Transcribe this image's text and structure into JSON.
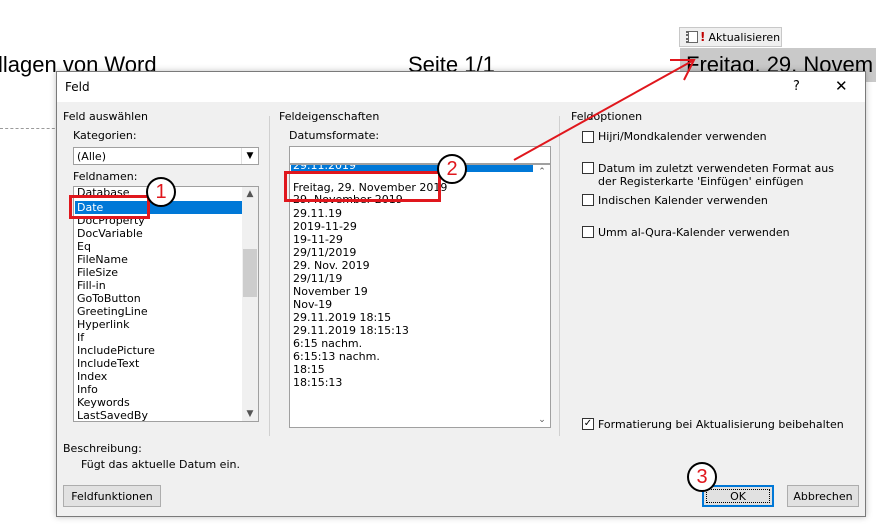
{
  "document": {
    "left_text": "llagen von Word",
    "center_text": "Seite 1/1",
    "update_button_label": "Aktualisieren",
    "field_value": "Freitag, 29. Novem"
  },
  "dialog": {
    "title": "Feld",
    "help_label": "?",
    "close_label": "✕",
    "left": {
      "section_title": "Feld auswählen",
      "category_label": "Kategorien:",
      "category_value": "(Alle)",
      "fieldnames_label": "Feldnamen:",
      "fieldnames": [
        "Database",
        "Date",
        "DocProperty",
        "DocVariable",
        "Eq",
        "FileName",
        "FileSize",
        "Fill-in",
        "GoToButton",
        "GreetingLine",
        "Hyperlink",
        "If",
        "IncludePicture",
        "IncludeText",
        "Index",
        "Info",
        "Keywords",
        "LastSavedBy"
      ],
      "selected_fieldname": "Date"
    },
    "middle": {
      "section_title": "Feldeigenschaften",
      "formats_label": "Datumsformate:",
      "format_input_value": "",
      "formats": [
        "29.11.2019",
        "Freitag, 29. November 2019",
        "29. November 2019",
        "29.11.19",
        "2019-11-29",
        "19-11-29",
        "29/11/2019",
        "29. Nov. 2019",
        "29/11/19",
        "November 19",
        "Nov-19",
        "29.11.2019 18:15",
        "29.11.2019 18:15:13",
        "6:15 nachm.",
        "6:15:13 nachm.",
        "18:15",
        "18:15:13"
      ]
    },
    "right": {
      "section_title": "Feldoptionen",
      "options": [
        {
          "label": "Hijri/Mondkalender verwenden",
          "checked": false
        },
        {
          "label": "Datum im zuletzt verwendeten Format aus der Registerkarte 'Einfügen' einfügen",
          "checked": false
        },
        {
          "label": "Indischen Kalender verwenden",
          "checked": false
        },
        {
          "label": "Umm al-Qura-Kalender verwenden",
          "checked": false
        }
      ],
      "preserve_label": "Formatierung bei Aktualisierung beibehalten",
      "preserve_checked": true
    },
    "description_label": "Beschreibung:",
    "description_text": "Fügt das aktuelle Datum ein.",
    "buttons": {
      "field_codes": "Feldfunktionen",
      "ok": "OK",
      "cancel": "Abbrechen"
    }
  },
  "annotations": {
    "marker_1": "1",
    "marker_2": "2",
    "marker_3": "3",
    "marker_color": "#e0171d"
  },
  "colors": {
    "selection": "#0078d7",
    "dialog_bg": "#f0f0f0"
  }
}
